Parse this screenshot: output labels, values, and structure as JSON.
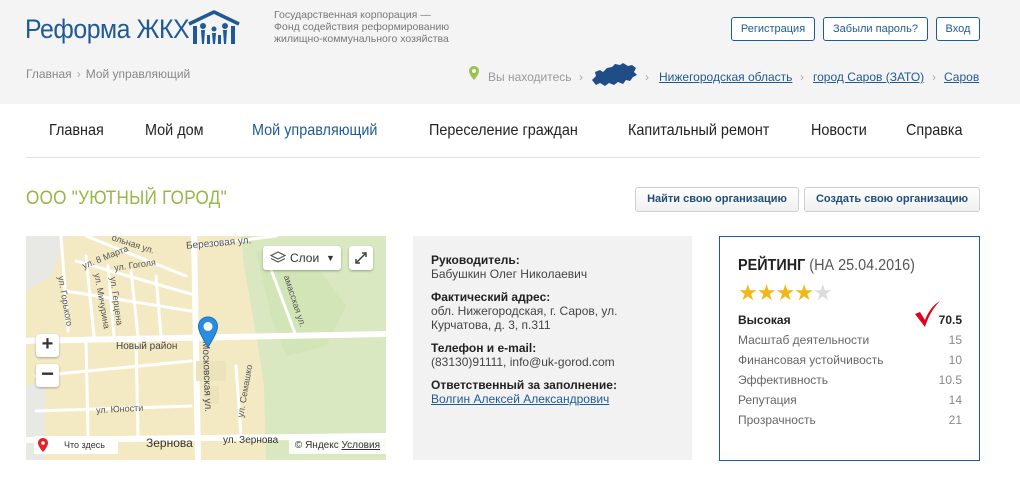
{
  "header": {
    "logo_text": "Реформа ЖКХ",
    "corp_line1": "Государственная корпорация —",
    "corp_line2": "Фонд содействия реформированию",
    "corp_line3": "жилищно-коммунального хозяйства",
    "register_label": "Регистрация",
    "forgot_label": "Забыли пароль?",
    "login_label": "Вход",
    "brand_color": "#1f5a96"
  },
  "breadcrumbs": {
    "home": "Главная",
    "current": "Мой управляющий"
  },
  "location": {
    "label": "Вы находитесь",
    "region": "Нижегородская область",
    "city": "город Саров (ЗАТО)",
    "town": "Саров"
  },
  "nav": {
    "items": [
      "Главная",
      "Мой дом",
      "Мой управляющий",
      "Переселение граждан",
      "Капитальный ремонт",
      "Новости",
      "Справка"
    ],
    "active": "Мой управляющий"
  },
  "org": {
    "title": "ООО \"УЮТНЫЙ ГОРОД\"",
    "find_label": "Найти свою организацию",
    "create_label": "Создать свою организацию",
    "title_color": "#94b84a"
  },
  "map": {
    "layers_label": "Слои",
    "here_label": "Что здесь",
    "copyright": "© Яндекс",
    "terms": "Условия",
    "streets": {
      "berezovaya": "Березовая ул.",
      "march8": "ул. 8 Марта",
      "gogolya": "ул. Гоголя",
      "gorkogo": "ул. Горького",
      "michurina": "ул. Мичурина",
      "gertsena": "ул. Герцена",
      "novy": "Новый район",
      "moskovskaya": "Московская ул.",
      "semashko": "ул. Семашко",
      "yunosti": "ул. Юности",
      "zernova": "Зернова",
      "ul_zernova": "ул. Зернова",
      "shkolnaya": "ольная ул.",
      "arzamasskaya": "амасская ул."
    }
  },
  "info": {
    "director_label": "Руководитель:",
    "director": "Бабушкин Олег Николаевич",
    "address_label": "Фактический адрес:",
    "address_line1": "обл. Нижегородская, г. Саров, ул.",
    "address_line2": "Курчатова, д. 3, п.311",
    "contact_label": "Телефон и e-mail:",
    "contact": "(83130)91111, info@uk-gorod.com",
    "responsible_label": "Ответственный за заполнение:",
    "responsible": "Волгин Алексей Александрович"
  },
  "rating": {
    "title": "РЕЙТИНГ",
    "date": "(НА 25.04.2016)",
    "stars_filled": 4,
    "stars_total": 5,
    "level": "Высокая",
    "score": "70.5",
    "rows": [
      {
        "label": "Масштаб деятельности",
        "value": "15"
      },
      {
        "label": "Финансовая устойчивость",
        "value": "10"
      },
      {
        "label": "Эффективность",
        "value": "10.5"
      },
      {
        "label": "Репутация",
        "value": "14"
      },
      {
        "label": "Прозрачность",
        "value": "21"
      }
    ],
    "star_color": "#f2b816",
    "check_color": "#e1001a"
  }
}
